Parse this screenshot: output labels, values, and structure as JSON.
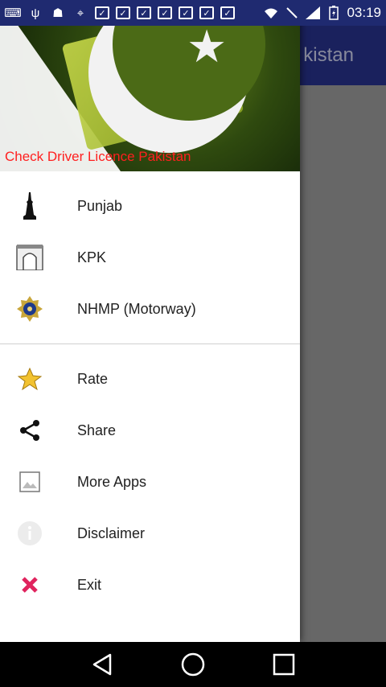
{
  "status_bar": {
    "time": "03:19",
    "left_icons": [
      "keyboard-icon",
      "usb-icon",
      "android-icon",
      "map-icon",
      "check-box-icon",
      "check-box-icon",
      "check-box-icon",
      "check-box-icon",
      "check-box-icon",
      "check-box-icon",
      "check-box-icon"
    ],
    "right_icons": [
      "wifi-icon",
      "no-signal-icon",
      "signal-icon",
      "battery-icon"
    ]
  },
  "app": {
    "title_fragment": "kistan"
  },
  "drawer": {
    "header_title": "Check Driver Licence Pakistan",
    "items": [
      {
        "label": "Punjab",
        "icon": "minar-icon"
      },
      {
        "label": "KPK",
        "icon": "gate-icon"
      },
      {
        "label": "NHMP (Motorway)",
        "icon": "badge-icon"
      }
    ],
    "secondary_items": [
      {
        "label": "Rate",
        "icon": "star-icon"
      },
      {
        "label": "Share",
        "icon": "share-icon"
      },
      {
        "label": "More Apps",
        "icon": "image-icon"
      },
      {
        "label": "Disclaimer",
        "icon": "info-icon"
      },
      {
        "label": "Exit",
        "icon": "close-icon"
      }
    ]
  },
  "colors": {
    "accent": "#29338f",
    "header_title": "#ff1f1f",
    "exit_icon": "#e0245e"
  }
}
